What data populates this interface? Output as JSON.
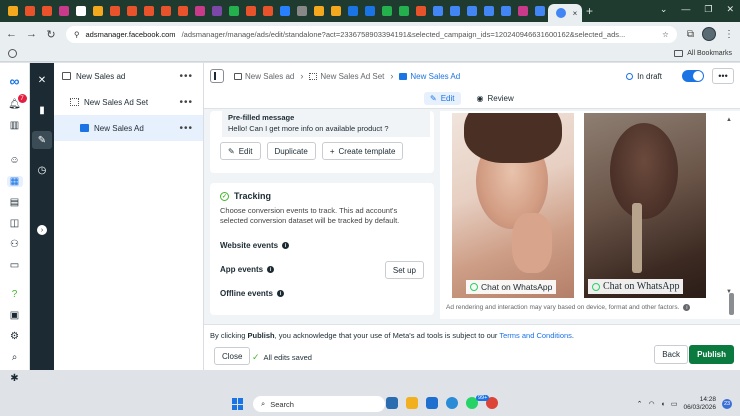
{
  "browser": {
    "tab_colors": [
      "#f4a81d",
      "#e8532b",
      "#e8532b",
      "#c93a8a",
      "#ffffff",
      "#f4a81d",
      "#e8532b",
      "#e8532b",
      "#e8532b",
      "#e8532b",
      "#e8532b",
      "#c93a8a",
      "#7b48a8",
      "#23b04d",
      "#e8532b",
      "#e8532b",
      "#2980ff",
      "#888888",
      "#f4a81d",
      "#f4a81d",
      "#1b74e4",
      "#1b74e4",
      "#23b04d",
      "#23b04d",
      "#e8532b",
      "#4285f4",
      "#4285f4",
      "#4285f4",
      "#4285f4",
      "#4285f4",
      "#c93a8a",
      "#4285f4"
    ],
    "active_tab_close": "×",
    "new_tab": "+",
    "url_domain": "adsmanager.facebook.com",
    "url_path": "/adsmanager/manage/ads/edit/standalone?act=233675890339419​1&selected_campaign_ids=120240946631600162&selected_ads...",
    "all_bookmarks": "All Bookmarks"
  },
  "rail": {
    "notification_count": "7"
  },
  "tree": {
    "items": [
      {
        "label": "New Sales ad",
        "more": "•••"
      },
      {
        "label": "New Sales Ad Set",
        "more": "•••"
      },
      {
        "label": "New Sales Ad",
        "more": "•••"
      }
    ]
  },
  "header": {
    "crumbs": [
      "New Sales ad",
      "New Sales Ad Set",
      "New Sales Ad"
    ],
    "status": "In draft",
    "more": "•••",
    "edit_label": "Edit",
    "review_label": "Review"
  },
  "prefill": {
    "title": "Pre-filled message",
    "text": "Hello! Can I get more info on available product ?",
    "edit_btn": "Edit",
    "duplicate_btn": "Duplicate",
    "create_template_btn": "Create template"
  },
  "tracking": {
    "title": "Tracking",
    "description": "Choose conversion events to track. This ad account's selected conversion dataset will be tracked by default.",
    "website_events": "Website events",
    "app_events": "App events",
    "offline_events": "Offline events",
    "setup_btn": "Set up"
  },
  "preview": {
    "cta_1": "Chat on WhatsApp",
    "cta_2": "Chat on WhatsApp",
    "disclaimer": "Ad rendering and interaction may vary based on device, format and other factors."
  },
  "footer": {
    "legal_prefix": "By clicking ",
    "legal_bold": "Publish",
    "legal_mid": ", you acknowledge that your use of Meta's ad tools is subject to our ",
    "legal_link": "Terms and Conditions",
    "legal_end": ".",
    "close_btn": "Close",
    "saved": "All edits saved",
    "back_btn": "Back",
    "publish_btn": "Publish"
  },
  "taskbar": {
    "search_placeholder": "Search",
    "badge": "99+",
    "time": "14:28",
    "date": "06/03/2026",
    "tray_badge": "23"
  }
}
